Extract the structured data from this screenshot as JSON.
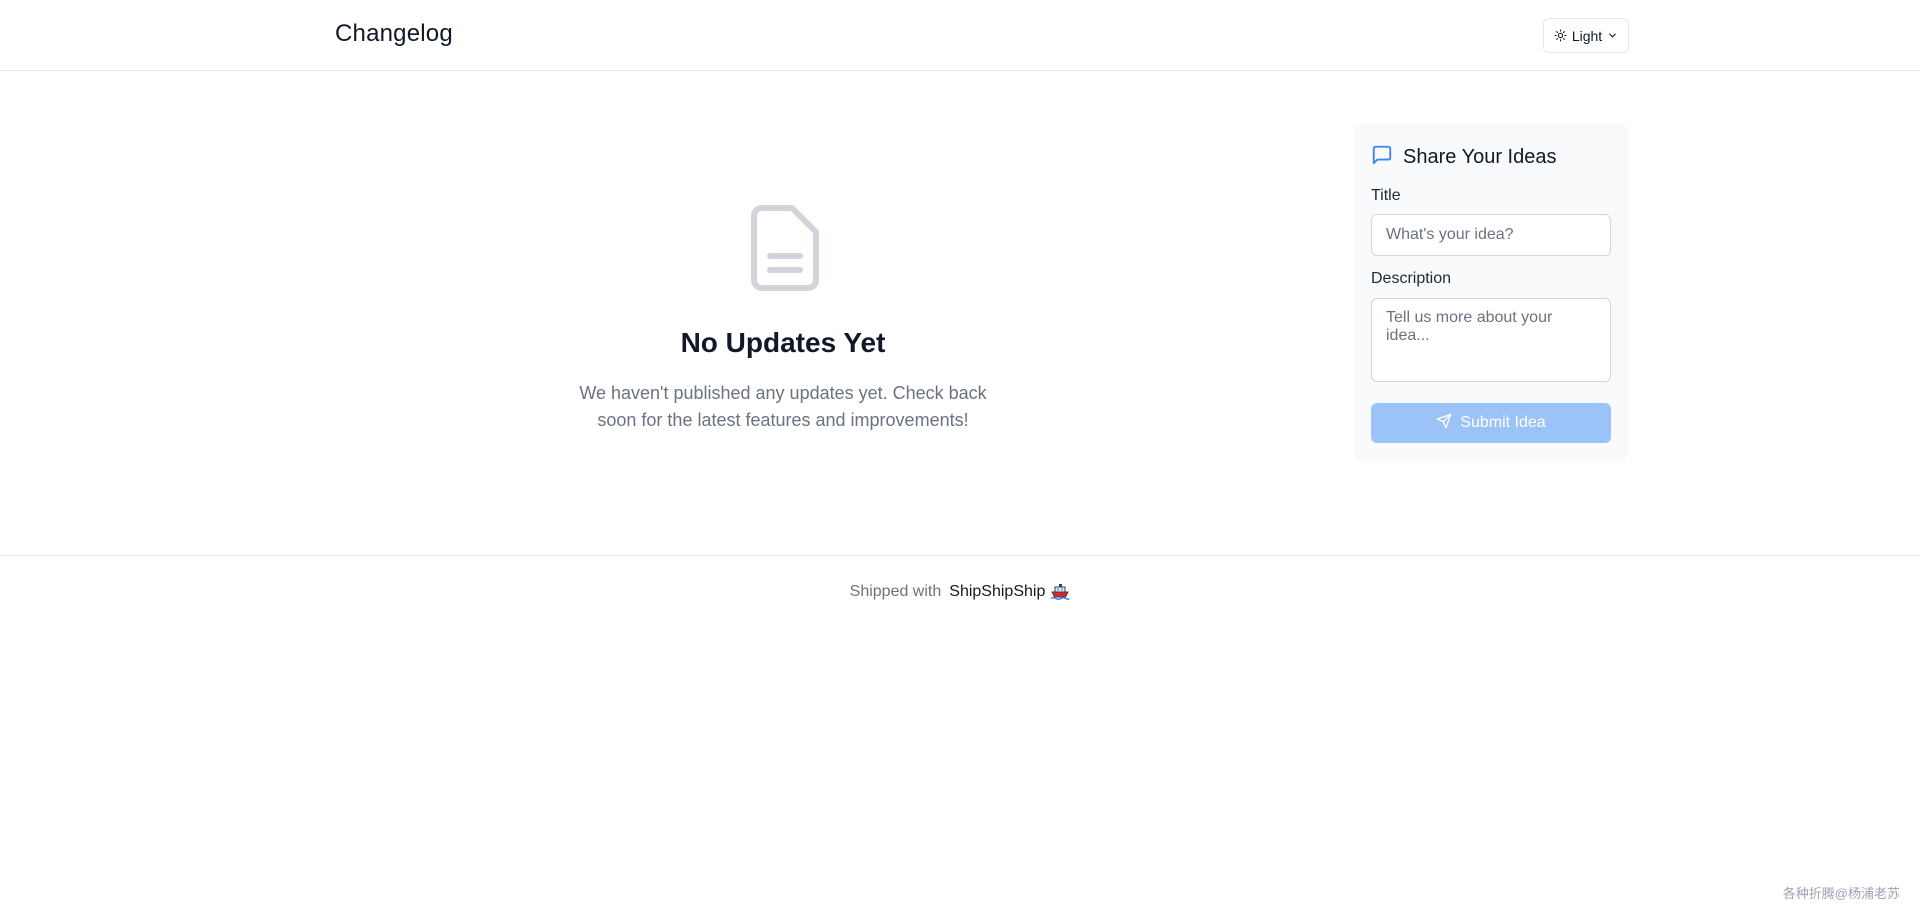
{
  "header": {
    "brand": "Changelog",
    "theme_label": "Light"
  },
  "empty_state": {
    "title": "No Updates Yet",
    "description": "We haven't published any updates yet. Check back soon for the latest features and improvements!"
  },
  "idea_form": {
    "heading": "Share Your Ideas",
    "title_label": "Title",
    "title_placeholder": "What's your idea?",
    "description_label": "Description",
    "description_placeholder": "Tell us more about your idea...",
    "submit_label": "Submit Idea"
  },
  "footer": {
    "prefix": "Shipped with",
    "brand": "ShipShipShip"
  },
  "watermark": "各种折腾@杨浦老苏",
  "colors": {
    "accent": "#3b82f6",
    "submit_disabled": "#9cc3f8",
    "muted_text": "#6b7280",
    "icon_gray": "#d1d5db"
  },
  "icons": {
    "theme": "sun-icon",
    "theme_dropdown": "chevron-down-icon",
    "empty": "document-icon",
    "ideas": "message-square-icon",
    "submit": "send-icon",
    "footer": "ship-emoji-icon"
  }
}
